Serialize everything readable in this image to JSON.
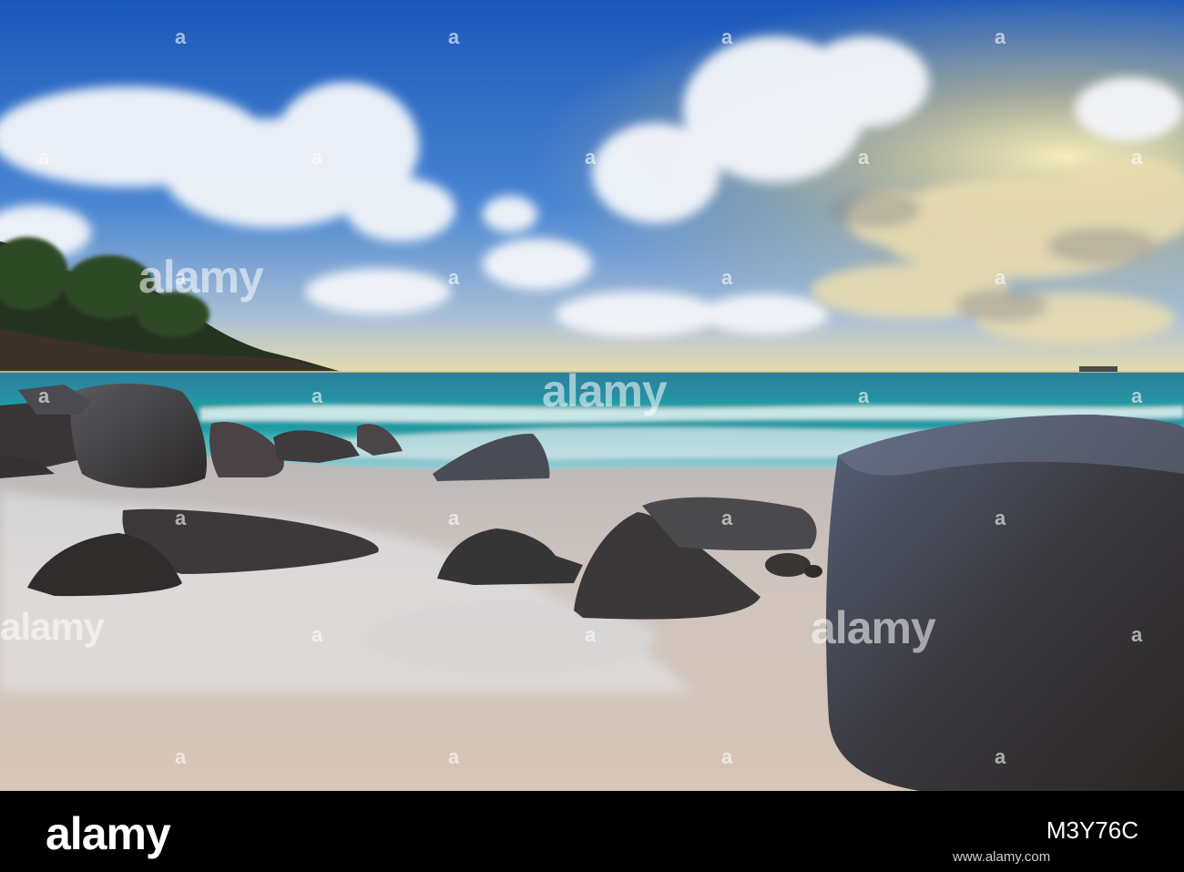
{
  "image": {
    "alt": "Beach with granite boulders, turquoise waves and a cloudy blue sky at sunset",
    "colors": {
      "sky_top": "#1f5fbf",
      "sky_mid": "#4a86d2",
      "horizon_glow": "#f3d98a",
      "sea": "#2ea9b3",
      "sand": "#cbbfb6",
      "rock": "#3a3737"
    }
  },
  "watermark": {
    "brand": "alamy",
    "glyph": "a"
  },
  "footer": {
    "brand": "alamy",
    "image_id": "M3Y76C",
    "url": "www.alamy.com"
  }
}
